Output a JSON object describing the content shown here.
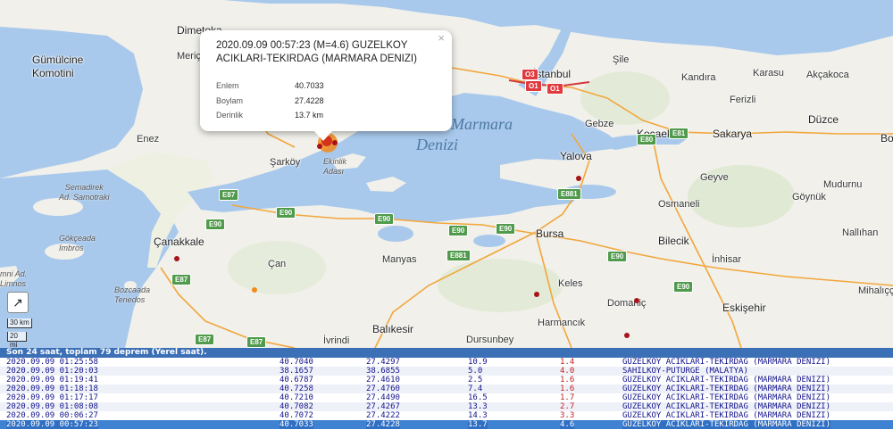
{
  "popup": {
    "title": "2020.09.09 00:57:23 (M=4.6) GUZELKOY ACIKLARI-TEKIRDAG (MARMARA DENIZI)",
    "close": "×",
    "rows": [
      {
        "label": "Enlem",
        "value": "40.7033"
      },
      {
        "label": "Boylam",
        "value": "27.4228"
      },
      {
        "label": "Derinlik",
        "value": "13.7 km"
      }
    ]
  },
  "places": {
    "dimetoka": "Dimetoka",
    "meric": "Meriç",
    "gumulcine": "Gümülcine",
    "komotini": "Komotini",
    "enez": "Enez",
    "sarkoy": "Şarköy",
    "canakkale": "Çanakkale",
    "can": "Çan",
    "manyas": "Manyas",
    "bursa": "Bursa",
    "keles": "Keles",
    "harmancik": "Harmancık",
    "domanic": "Domaniç",
    "balikesir": "Balıkesir",
    "ivrindi": "İvrindi",
    "dursunbey": "Dursunbey",
    "istanbul": "İstanbul",
    "sile": "Şile",
    "kandira": "Kandıra",
    "karasu": "Karasu",
    "akcakoca": "Akçakoca",
    "ferizli": "Ferizli",
    "duzce": "Düzce",
    "gebze": "Gebze",
    "kocaeli": "Kocaeli",
    "sakarya": "Sakarya",
    "yalova": "Yalova",
    "geyve": "Geyve",
    "goynuk": "Göynük",
    "mudurnu": "Mudurnu",
    "osmaneli": "Osmaneli",
    "bilecik": "Bilecik",
    "inhisar": "İnhisar",
    "nallihan": "Nallıhan",
    "eskisehir": "Eskişehir",
    "mihalicc": "Mihalıçç",
    "bo": "Bo"
  },
  "water": {
    "marmara_1": "Marmara",
    "marmara_2": "Denizi",
    "semadirek_1": "Semadirek",
    "semadirek_2": "Ad. Samotraki",
    "gokceada_1": "Gökçeada",
    "gokceada_2": "Imbros",
    "bozcaada_1": "Bozcaada",
    "bozcaada_2": "Tenedos",
    "ekinlik_1": "Ekinlik",
    "ekinlik_2": "Adası",
    "limni_1": "mni Ad.",
    "limni_2": "Limnos"
  },
  "roads": [
    "E87",
    "E87",
    "E90",
    "E90",
    "E90",
    "E90",
    "E881",
    "E881",
    "E90",
    "E90",
    "E90",
    "E80",
    "E81",
    "E87",
    "E87",
    "O1",
    "O1",
    "O3"
  ],
  "scale": {
    "km": "30 km",
    "mi": "20 mi"
  },
  "list": {
    "header": "Son 24 saat, toplam 79 deprem (Yerel saat).",
    "rows": [
      [
        "2020.09.09 01:25:58",
        "40.7040",
        "27.4297",
        "10.9",
        "1.4",
        "GUZELKOY ACIKLARI-TEKIRDAG (MARMARA DENIZI)"
      ],
      [
        "2020.09.09 01:20:03",
        "38.1657",
        "38.6855",
        "5.0",
        "4.0",
        "SAHILKOY-PUTURGE (MALATYA)"
      ],
      [
        "2020.09.09 01:19:41",
        "40.6787",
        "27.4610",
        "2.5",
        "1.6",
        "GUZELKOY ACIKLARI-TEKIRDAG (MARMARA DENIZI)"
      ],
      [
        "2020.09.09 01:18:18",
        "40.7258",
        "27.4760",
        "7.4",
        "1.6",
        "GUZELKOY ACIKLARI-TEKIRDAG (MARMARA DENIZI)"
      ],
      [
        "2020.09.09 01:17:17",
        "40.7210",
        "27.4490",
        "16.5",
        "1.7",
        "GUZELKOY ACIKLARI-TEKIRDAG (MARMARA DENIZI)"
      ],
      [
        "2020.09.09 01:08:08",
        "40.7082",
        "27.4267",
        "13.3",
        "2.7",
        "GUZELKOY ACIKLARI-TEKIRDAG (MARMARA DENIZI)"
      ],
      [
        "2020.09.09 00:06:27",
        "40.7072",
        "27.4222",
        "14.3",
        "3.3",
        "GUZELKOY ACIKLARI-TEKIRDAG (MARMARA DENIZI)"
      ],
      [
        "2020.09.09 00:57:23",
        "40.7033",
        "27.4228",
        "13.7",
        "4.6",
        "GUZELKOY ACIKLARI-TEKIRDAG (MARMARA DENIZI)"
      ]
    ],
    "selected_index": 7
  },
  "colors": {
    "land": "#f1f0ea",
    "sea": "#a9c9ec",
    "road": "#f2a63b",
    "quake": "#a8131a",
    "highlight": "#3f82d1"
  }
}
